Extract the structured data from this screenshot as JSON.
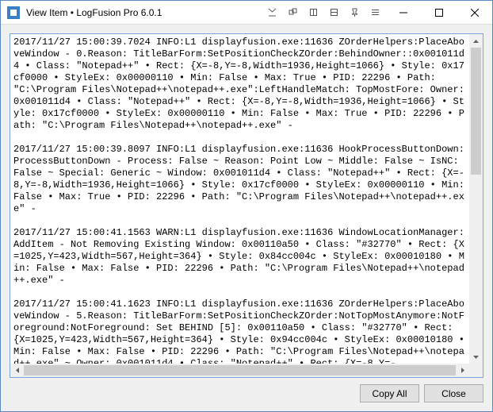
{
  "window": {
    "title": "View Item • LogFusion Pro 6.0.1"
  },
  "log": {
    "entries": [
      "2017/11/27 15:00:39.7024 INFO:L1 displayfusion.exe:11636 ZOrderHelpers:PlaceAboveWindow - 0.Reason: TitleBarForm:SetPositionCheckZOrder:BehindOwner::0x001011d4 • Class: \"Notepad++\" • Rect: {X=-8,Y=-8,Width=1936,Height=1066} • Style: 0x17cf0000 • StyleEx: 0x00000110 • Min: False • Max: True • PID: 22296 • Path: \"C:\\Program Files\\Notepad++\\notepad++.exe\":LeftHandleMatch: TopMostFore: Owner: 0x001011d4 • Class: \"Notepad++\" • Rect: {X=-8,Y=-8,Width=1936,Height=1066} • Style: 0x17cf0000 • StyleEx: 0x00000110 • Min: False • Max: True • PID: 22296 • Path: \"C:\\Program Files\\Notepad++\\notepad++.exe\" -",
      "2017/11/27 15:00:39.8097 INFO:L1 displayfusion.exe:11636 HookProcessButtonDown:ProcessButtonDown - Process: False ~ Reason: Point Low ~ Middle: False ~ IsNC: False ~ Special: Generic ~ Window: 0x001011d4 • Class: \"Notepad++\" • Rect: {X=-8,Y=-8,Width=1936,Height=1066} • Style: 0x17cf0000 • StyleEx: 0x00000110 • Min: False • Max: True • PID: 22296 • Path: \"C:\\Program Files\\Notepad++\\notepad++.exe\" -",
      "2017/11/27 15:00:41.1563 WARN:L1 displayfusion.exe:11636 WindowLocationManager:AddItem - Not Removing Existing Window: 0x00110a50 • Class: \"#32770\" • Rect: {X=1025,Y=423,Width=567,Height=364} • Style: 0x84cc004c • StyleEx: 0x00010180 • Min: False • Max: False • PID: 22296 • Path: \"C:\\Program Files\\Notepad++\\notepad++.exe\" -",
      "2017/11/27 15:00:41.1623 INFO:L1 displayfusion.exe:11636 ZOrderHelpers:PlaceAboveWindow - 5.Reason: TitleBarForm:SetPositionCheckZOrder:NotTopMostAnymore:NotForeground:NotForeground: Set BEHIND [5]: 0x00110a50 • Class: \"#32770\" • Rect: {X=1025,Y=423,Width=567,Height=364} • Style: 0x94cc004c • StyleEx: 0x00010180 • Min: False • Max: False • PID: 22296 • Path: \"C:\\Program Files\\Notepad++\\notepad++.exe\" ~ Owner: 0x001011d4 • Class: \"Notepad++\" • Rect: {X=-8,Y=-"
    ]
  },
  "buttons": {
    "copy_all": "Copy All",
    "close": "Close"
  }
}
